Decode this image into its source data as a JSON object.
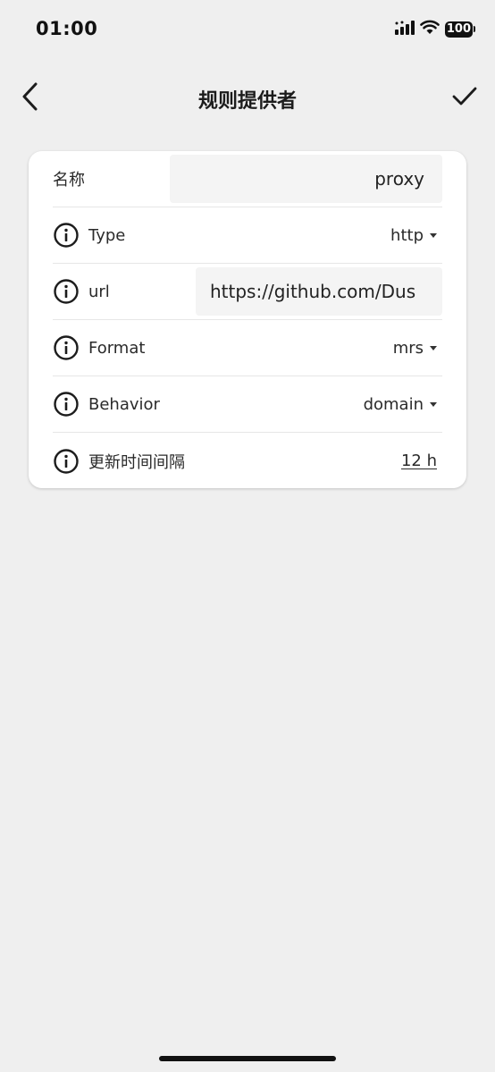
{
  "status_bar": {
    "time": "01:00",
    "battery": "100",
    "icons": [
      "cellular-signal-icon",
      "wifi-icon",
      "battery-icon"
    ]
  },
  "header": {
    "title": "规则提供者",
    "back_icon": "chevron-left-icon",
    "confirm_icon": "checkmark-icon"
  },
  "form": {
    "name": {
      "label": "名称",
      "value": "proxy"
    },
    "type": {
      "label": "Type",
      "value": "http",
      "icon": "info-circle-icon"
    },
    "url": {
      "label": "url",
      "value": "https://github.com/Dus",
      "icon": "info-circle-icon"
    },
    "format": {
      "label": "Format",
      "value": "mrs",
      "icon": "info-circle-icon"
    },
    "behavior": {
      "label": "Behavior",
      "value": "domain",
      "icon": "info-circle-icon"
    },
    "interval": {
      "label": "更新时间间隔",
      "value": "12 h",
      "icon": "info-circle-icon"
    }
  }
}
